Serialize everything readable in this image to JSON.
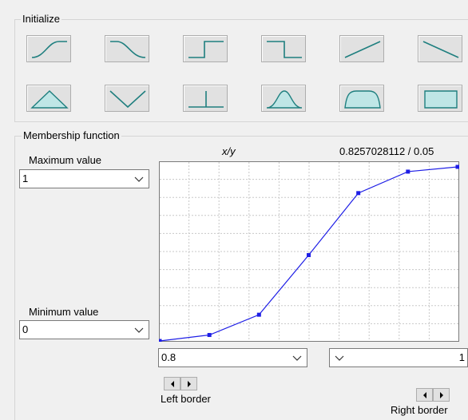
{
  "initialize": {
    "title": "Initialize",
    "shapes": [
      "s-curve-rising-icon",
      "s-curve-falling-icon",
      "step-up-icon",
      "step-down-icon",
      "linear-rising-icon",
      "linear-falling-icon",
      "triangle-icon",
      "v-shape-icon",
      "singleton-icon",
      "bell-icon",
      "trapezoid-icon",
      "rectangle-icon"
    ]
  },
  "membership": {
    "title": "Membership function",
    "xy_label": "x/y",
    "cursor_readout": "0.8257028112 / 0.05",
    "max_label": "Maximum value",
    "max_value": "1",
    "min_label": "Minimum value",
    "min_value": "0",
    "left_border_value": "0.8",
    "right_border_value": "1",
    "left_border_label": "Left border",
    "right_border_label": "Right border"
  },
  "colors": {
    "curve": "#1e1ee6",
    "icon_stroke": "#1f7f7f",
    "icon_fill": "#bfe6e6"
  },
  "chart_data": {
    "type": "line",
    "x": [
      0,
      0.1667,
      0.3333,
      0.5,
      0.6667,
      0.8333,
      1
    ],
    "y": [
      0,
      0.025,
      0.11,
      0.36,
      0.62,
      0.71,
      0.73
    ],
    "xlim": [
      0,
      1
    ],
    "ylim": [
      0,
      0.75
    ],
    "grid": true
  }
}
